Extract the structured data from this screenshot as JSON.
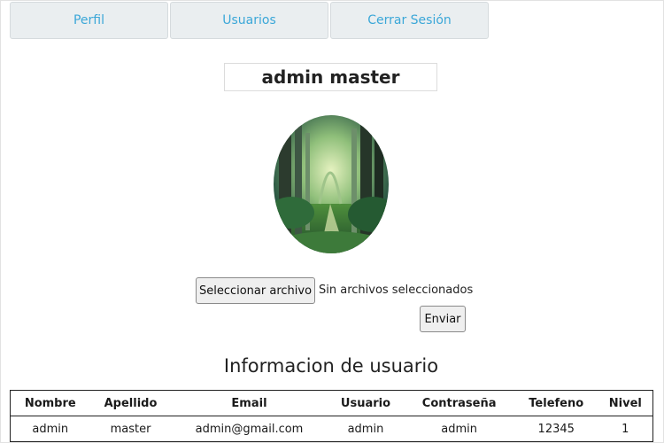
{
  "nav": {
    "tabs": [
      "Perfil",
      "Usuarios",
      "Cerrar Sesión"
    ]
  },
  "profile": {
    "display_name": "admin master"
  },
  "upload": {
    "choose_button": "Seleccionar archivo",
    "status": "Sin archivos seleccionados",
    "submit_button": "Enviar"
  },
  "info": {
    "title": "Informacion de usuario",
    "columns": [
      "Nombre",
      "Apellido",
      "Email",
      "Usuario",
      "Contraseña",
      "Telefeno",
      "Nivel"
    ],
    "row": [
      "admin",
      "master",
      "admin@gmail.com",
      "admin",
      "admin",
      "12345",
      "1"
    ]
  },
  "colors": {
    "nav_text": "#3ba7d8",
    "nav_bg": "#eaeef0"
  }
}
